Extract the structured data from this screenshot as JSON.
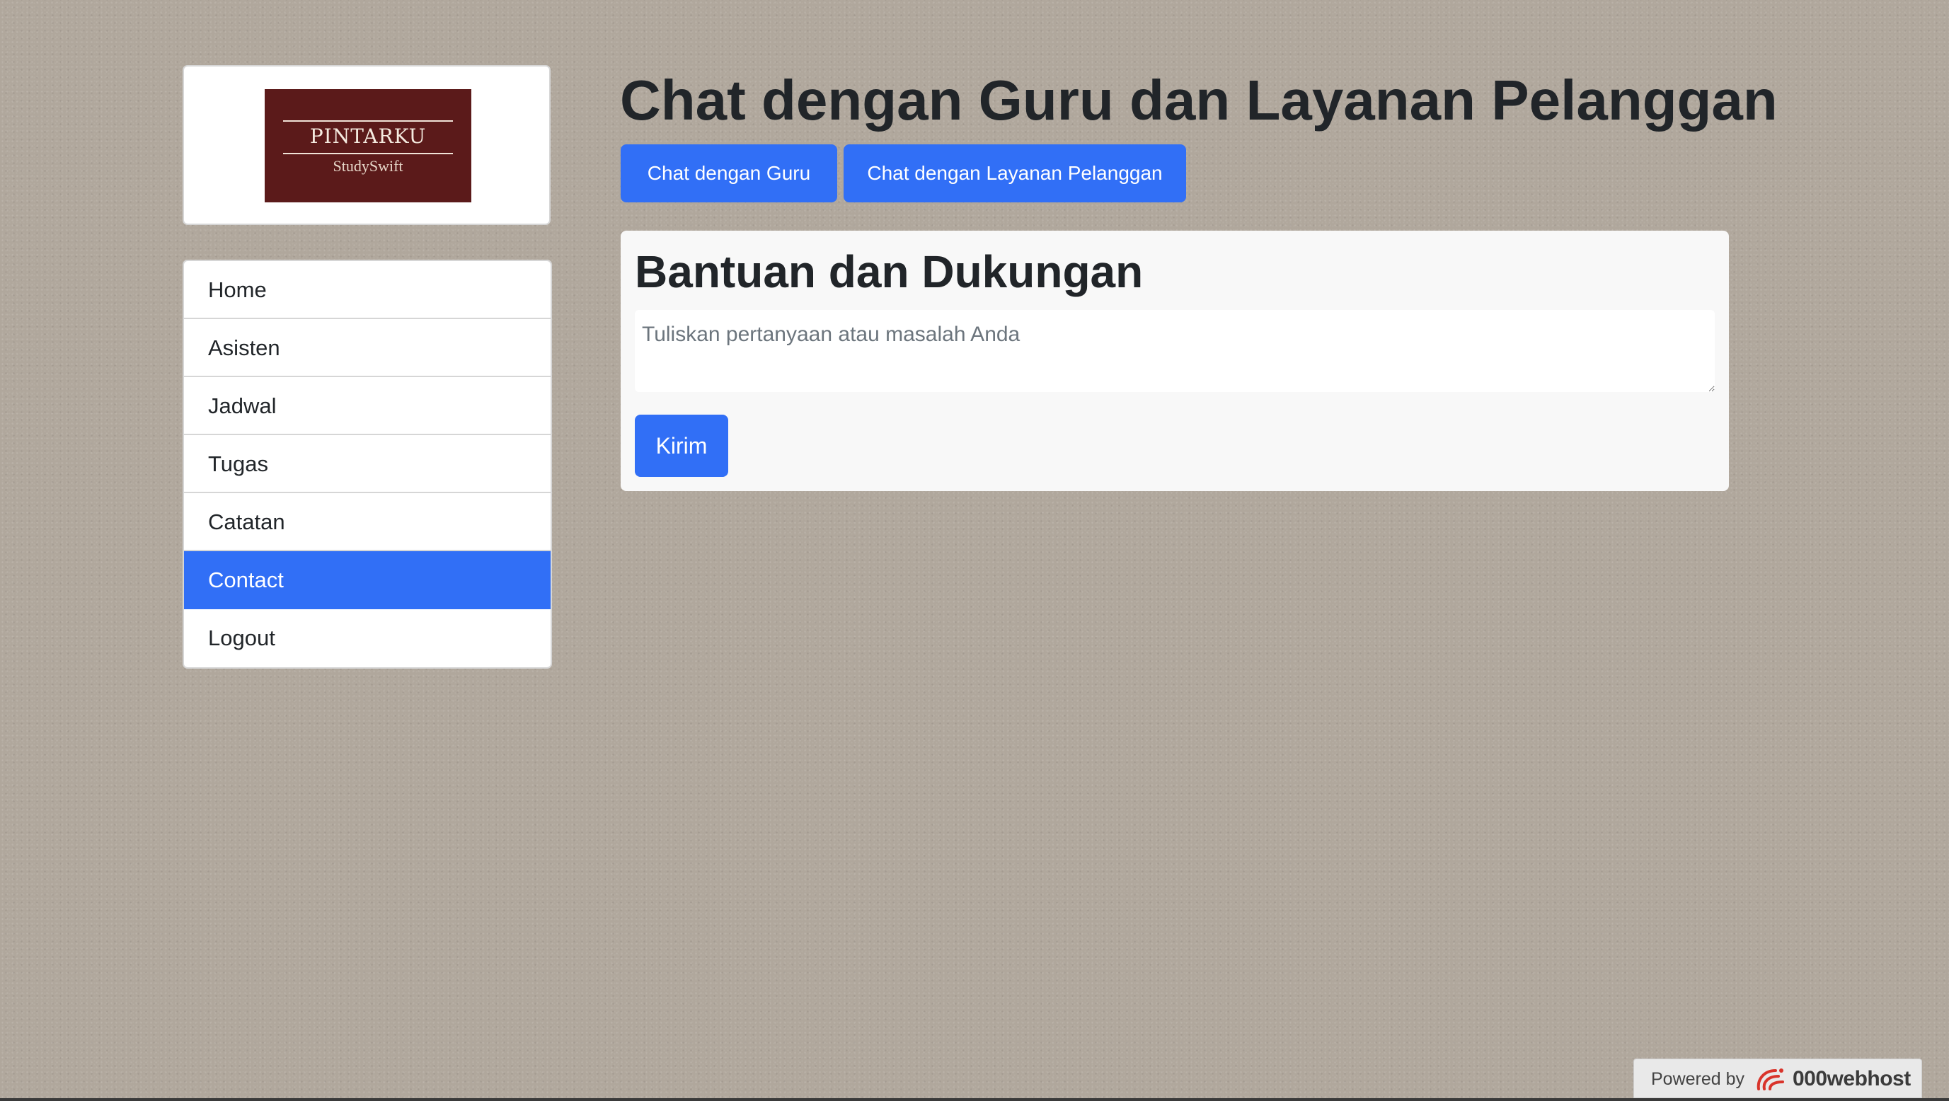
{
  "logo": {
    "name": "PINTARKU",
    "tagline": "StudySwift",
    "color": "#5b1a1a"
  },
  "sidebar": {
    "items": [
      {
        "label": "Home"
      },
      {
        "label": "Asisten"
      },
      {
        "label": "Jadwal"
      },
      {
        "label": "Tugas"
      },
      {
        "label": "Catatan"
      },
      {
        "label": "Contact",
        "active": true
      },
      {
        "label": "Logout"
      }
    ]
  },
  "main": {
    "title": "Chat dengan Guru dan Layanan Pelanggan",
    "buttons": {
      "guru": "Chat dengan Guru",
      "cs": "Chat dengan Layanan Pelanggan"
    },
    "support": {
      "title": "Bantuan dan Dukungan",
      "placeholder": "Tuliskan pertanyaan atau masalah Anda",
      "value": "",
      "submit": "Kirim"
    }
  },
  "footer": {
    "powered_by": "Powered by",
    "host": "000webhost",
    "host_icon": "000webhost-logo-icon"
  },
  "colors": {
    "accent": "#316ff6",
    "background": "#b0a79c",
    "text": "#212529"
  }
}
